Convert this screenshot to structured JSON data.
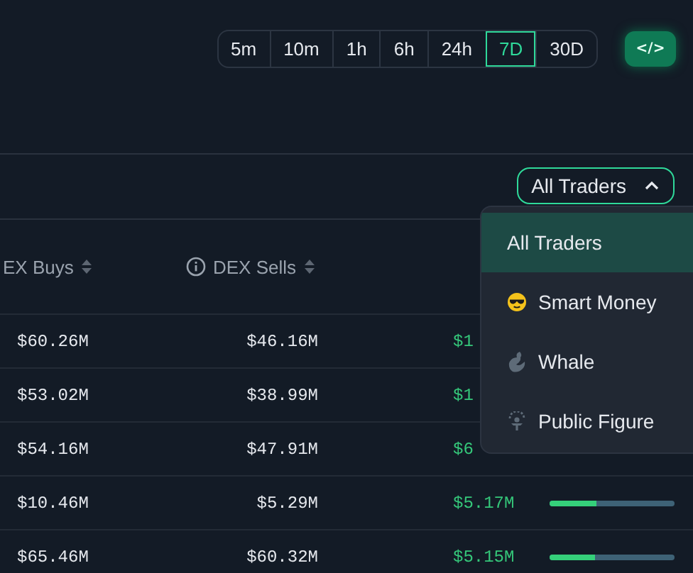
{
  "time_ranges": [
    {
      "label": "5m",
      "selected": false
    },
    {
      "label": "10m",
      "selected": false
    },
    {
      "label": "1h",
      "selected": false
    },
    {
      "label": "6h",
      "selected": false
    },
    {
      "label": "24h",
      "selected": false
    },
    {
      "label": "7D",
      "selected": true
    },
    {
      "label": "30D",
      "selected": false
    }
  ],
  "code_button": {
    "label": "</>"
  },
  "trader_filter": {
    "label": "All Traders",
    "expanded": true,
    "options": [
      {
        "label": "All Traders",
        "kind": "all",
        "selected": true
      },
      {
        "label": "Smart Money",
        "kind": "smart",
        "selected": false
      },
      {
        "label": "Whale",
        "kind": "whale",
        "selected": false
      },
      {
        "label": "Public Figure",
        "kind": "public",
        "selected": false
      }
    ]
  },
  "table": {
    "columns": [
      {
        "label": "EX Buys",
        "info": false
      },
      {
        "label": "DEX Sells",
        "info": true
      }
    ],
    "rows": [
      {
        "buys": "$60.26M",
        "sells": "$46.16M",
        "net": "$1"
      },
      {
        "buys": "$53.02M",
        "sells": "$38.99M",
        "net": "$1"
      },
      {
        "buys": "$54.16M",
        "sells": "$47.91M",
        "net": "$6"
      },
      {
        "buys": "$10.46M",
        "sells": "$5.29M",
        "net": "$5.17M",
        "level": 0.37
      },
      {
        "buys": "$65.46M",
        "sells": "$60.32M",
        "net": "$5.15M",
        "level": 0.36
      }
    ]
  }
}
